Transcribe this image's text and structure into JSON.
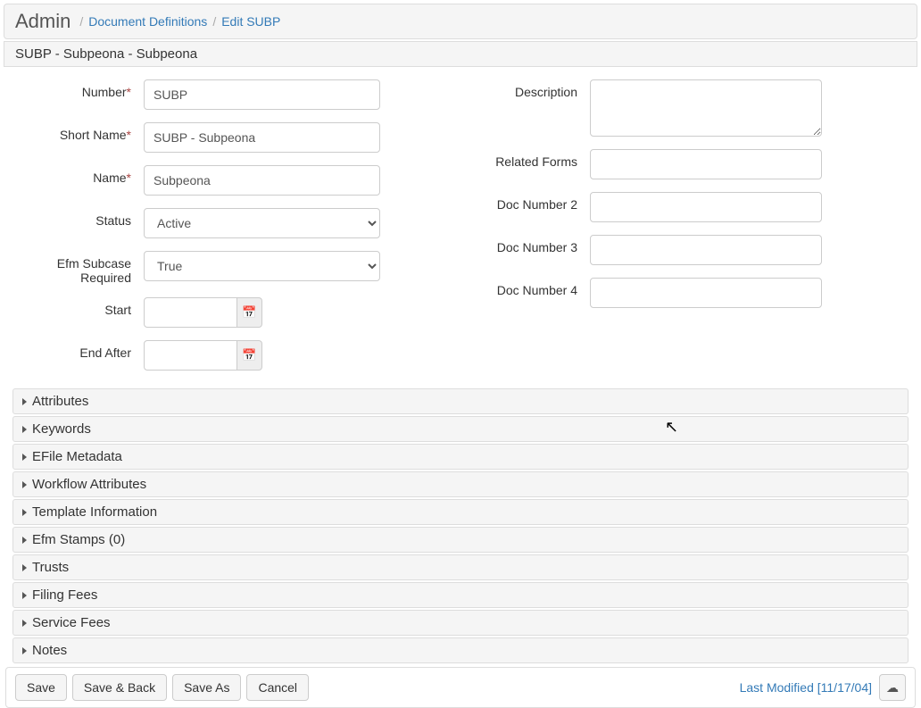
{
  "breadcrumb": {
    "admin": "Admin",
    "link1": "Document Definitions",
    "link2": "Edit SUBP"
  },
  "sectionTitle": "SUBP - Subpeona - Subpeona",
  "labels": {
    "number": "Number",
    "shortName": "Short Name",
    "name": "Name",
    "status": "Status",
    "efmSubcase": "Efm Subcase Required",
    "start": "Start",
    "endAfter": "End After",
    "description": "Description",
    "relatedForms": "Related Forms",
    "docNumber2": "Doc Number 2",
    "docNumber3": "Doc Number 3",
    "docNumber4": "Doc Number 4"
  },
  "values": {
    "number": "SUBP",
    "shortName": "SUBP - Subpeona",
    "name": "Subpeona",
    "status": "Active",
    "efmSubcase": "True",
    "start": "",
    "endAfter": "",
    "description": "",
    "relatedForms": "",
    "docNumber2": "",
    "docNumber3": "",
    "docNumber4": ""
  },
  "statusOptions": [
    "Active"
  ],
  "efmOptions": [
    "True"
  ],
  "accordion": [
    "Attributes",
    "Keywords",
    "EFile Metadata",
    "Workflow Attributes",
    "Template Information",
    "Efm Stamps (0)",
    "Trusts",
    "Filing Fees",
    "Service Fees",
    "Notes"
  ],
  "footer": {
    "save": "Save",
    "saveBack": "Save & Back",
    "saveAs": "Save As",
    "cancel": "Cancel",
    "lastModified": "Last Modified [11/17/04]"
  },
  "icons": {
    "calendar": "📅",
    "cloudUp": "☁"
  }
}
